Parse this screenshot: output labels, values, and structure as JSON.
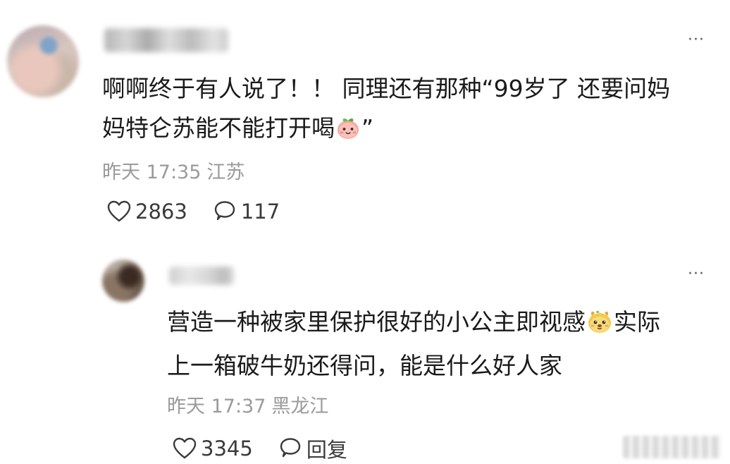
{
  "comments": [
    {
      "text_line1": "啊啊终于有人说了！！ 同理还有那种“99岁了 还要问妈",
      "text_line2_before": "妈特仑苏能不能打开喝",
      "text_line2_after": "”",
      "emoji": "peach-face-emoji",
      "time": "昨天 17:35",
      "location": "江苏",
      "likes": "2863",
      "replies": "117",
      "more_label": "···"
    },
    {
      "text_line1_before": "营造一种被家里保护很好的小公主即视感",
      "text_line1_after": "实际",
      "text_line2": "上一箱破牛奶还得问，能是什么好人家",
      "emoji": "dog-face-emoji",
      "time": "昨天 17:37",
      "location": "黑龙江",
      "likes": "3345",
      "reply_label": "回复",
      "more_label": "···"
    }
  ],
  "colors": {
    "text": "#1a1a1a",
    "meta": "#9a9a9a",
    "icon": "#3a3a3a"
  },
  "icons": [
    "heart-outline-icon",
    "comment-bubble-icon",
    "more-icon"
  ]
}
